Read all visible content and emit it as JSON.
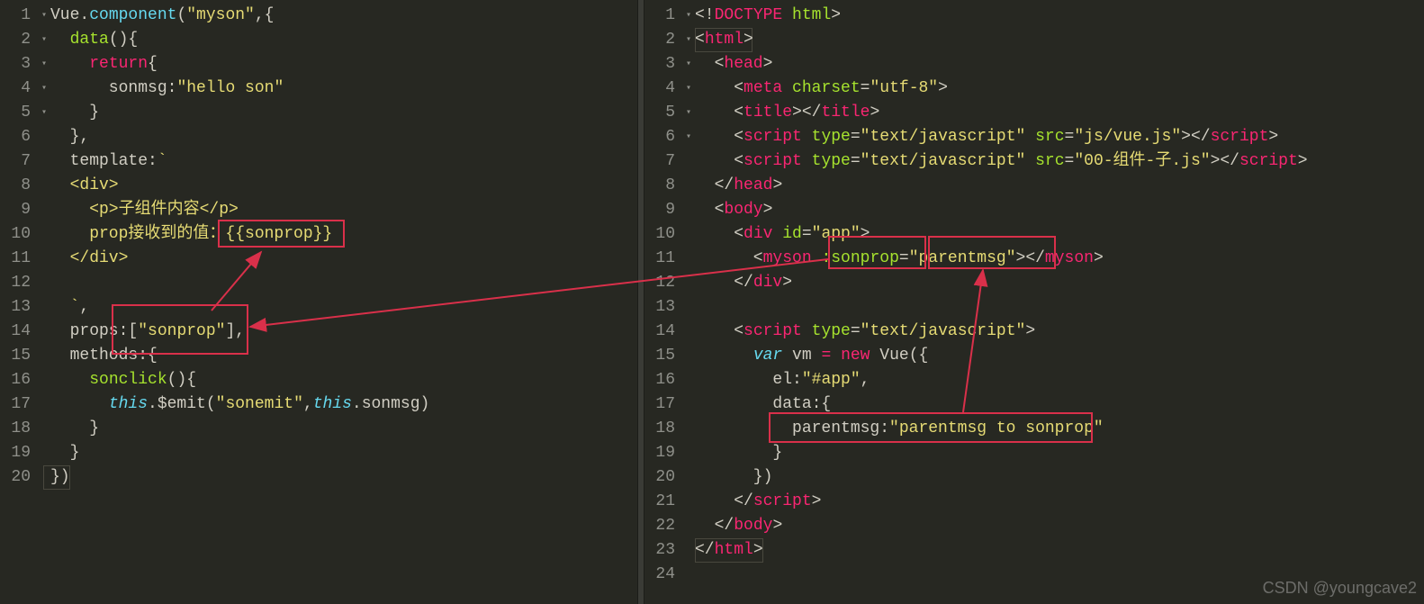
{
  "left": {
    "lines": {
      "l1": {
        "segments": [
          {
            "t": "Vue",
            "c": "default"
          },
          {
            "t": ".",
            "c": "punct"
          },
          {
            "t": "component",
            "c": "builtin"
          },
          {
            "t": "(",
            "c": "punct"
          },
          {
            "t": "\"myson\"",
            "c": "string"
          },
          {
            "t": ",{",
            "c": "punct"
          }
        ]
      },
      "l2": {
        "segments": [
          {
            "t": "  ",
            "c": "default"
          },
          {
            "t": "data",
            "c": "name"
          },
          {
            "t": "(){",
            "c": "punct"
          }
        ]
      },
      "l3": {
        "segments": [
          {
            "t": "    ",
            "c": "default"
          },
          {
            "t": "return",
            "c": "keyword"
          },
          {
            "t": "{",
            "c": "punct"
          }
        ]
      },
      "l4": {
        "segments": [
          {
            "t": "      sonmsg",
            "c": "default"
          },
          {
            "t": ":",
            "c": "punct"
          },
          {
            "t": "\"hello son\"",
            "c": "string"
          }
        ]
      },
      "l5": {
        "segments": [
          {
            "t": "    }",
            "c": "punct"
          }
        ]
      },
      "l6": {
        "segments": [
          {
            "t": "  },",
            "c": "punct"
          }
        ]
      },
      "l7": {
        "segments": [
          {
            "t": "  template",
            "c": "default"
          },
          {
            "t": ":",
            "c": "punct"
          },
          {
            "t": "`",
            "c": "tstr"
          }
        ]
      },
      "l8": {
        "segments": [
          {
            "t": "  <div>",
            "c": "tstr"
          }
        ]
      },
      "l9": {
        "segments": [
          {
            "t": "    <p>子组件内容</p>",
            "c": "tstr"
          }
        ]
      },
      "l10": {
        "segments": [
          {
            "t": "    prop接收到的值：{{sonprop}}",
            "c": "tstr"
          }
        ]
      },
      "l11": {
        "segments": [
          {
            "t": "  </div>",
            "c": "tstr"
          }
        ]
      },
      "l12": {
        "segments": [
          {
            "t": "",
            "c": "default"
          }
        ]
      },
      "l13": {
        "segments": [
          {
            "t": "  `",
            "c": "tstr"
          },
          {
            "t": ",",
            "c": "punct"
          }
        ]
      },
      "l14": {
        "segments": [
          {
            "t": "  props",
            "c": "default"
          },
          {
            "t": ":[",
            "c": "punct"
          },
          {
            "t": "\"sonprop\"",
            "c": "string"
          },
          {
            "t": "],",
            "c": "punct"
          }
        ]
      },
      "l15": {
        "segments": [
          {
            "t": "  methods",
            "c": "default"
          },
          {
            "t": ":{",
            "c": "punct"
          }
        ]
      },
      "l16": {
        "segments": [
          {
            "t": "    ",
            "c": "default"
          },
          {
            "t": "sonclick",
            "c": "name"
          },
          {
            "t": "(){",
            "c": "punct"
          }
        ]
      },
      "l17": {
        "segments": [
          {
            "t": "      ",
            "c": "default"
          },
          {
            "t": "this",
            "c": "this"
          },
          {
            "t": ".$emit(",
            "c": "punct"
          },
          {
            "t": "\"sonemit\"",
            "c": "string"
          },
          {
            "t": ",",
            "c": "punct"
          },
          {
            "t": "this",
            "c": "this"
          },
          {
            "t": ".sonmsg)",
            "c": "punct"
          }
        ]
      },
      "l18": {
        "segments": [
          {
            "t": "    }",
            "c": "punct"
          }
        ]
      },
      "l19": {
        "segments": [
          {
            "t": "  }",
            "c": "punct"
          }
        ]
      },
      "l20": {
        "segments": [
          {
            "t": "})",
            "c": "punct"
          }
        ]
      }
    },
    "gutter": [
      "1",
      "2",
      "3",
      "4",
      "5",
      "6",
      "7",
      "8",
      "9",
      "10",
      "11",
      "12",
      "13",
      "14",
      "15",
      "16",
      "17",
      "18",
      "19",
      "20"
    ],
    "folds": [
      "▾",
      "▾",
      "▾",
      "",
      "",
      "",
      "",
      "",
      "",
      "",
      "",
      "",
      "",
      "",
      "▾",
      "▾",
      "",
      "",
      "",
      ""
    ]
  },
  "right": {
    "lines": {
      "l1": {
        "segments": [
          {
            "t": "<!",
            "c": "punct"
          },
          {
            "t": "DOCTYPE",
            "c": "tag"
          },
          {
            "t": " ",
            "c": "default"
          },
          {
            "t": "html",
            "c": "attr"
          },
          {
            "t": ">",
            "c": "punct"
          }
        ]
      },
      "l2": {
        "segments": [
          {
            "t": "<",
            "c": "punct"
          },
          {
            "t": "html",
            "c": "tag"
          },
          {
            "t": ">",
            "c": "punct"
          }
        ]
      },
      "l3": {
        "segments": [
          {
            "t": "  <",
            "c": "punct"
          },
          {
            "t": "head",
            "c": "tag"
          },
          {
            "t": ">",
            "c": "punct"
          }
        ]
      },
      "l4": {
        "segments": [
          {
            "t": "    <",
            "c": "punct"
          },
          {
            "t": "meta",
            "c": "tag"
          },
          {
            "t": " ",
            "c": "default"
          },
          {
            "t": "charset",
            "c": "attr"
          },
          {
            "t": "=",
            "c": "punct"
          },
          {
            "t": "\"utf-8\"",
            "c": "string"
          },
          {
            "t": ">",
            "c": "punct"
          }
        ]
      },
      "l5": {
        "segments": [
          {
            "t": "    <",
            "c": "punct"
          },
          {
            "t": "title",
            "c": "tag"
          },
          {
            "t": "></",
            "c": "punct"
          },
          {
            "t": "title",
            "c": "tag"
          },
          {
            "t": ">",
            "c": "punct"
          }
        ]
      },
      "l6": {
        "segments": [
          {
            "t": "    <",
            "c": "punct"
          },
          {
            "t": "script",
            "c": "tag"
          },
          {
            "t": " ",
            "c": "default"
          },
          {
            "t": "type",
            "c": "attr"
          },
          {
            "t": "=",
            "c": "punct"
          },
          {
            "t": "\"text/javascript\"",
            "c": "string"
          },
          {
            "t": " ",
            "c": "default"
          },
          {
            "t": "src",
            "c": "attr"
          },
          {
            "t": "=",
            "c": "punct"
          },
          {
            "t": "\"js/vue.js\"",
            "c": "string"
          },
          {
            "t": "></",
            "c": "punct"
          },
          {
            "t": "script",
            "c": "tag"
          },
          {
            "t": ">",
            "c": "punct"
          }
        ]
      },
      "l7": {
        "segments": [
          {
            "t": "    <",
            "c": "punct"
          },
          {
            "t": "script",
            "c": "tag"
          },
          {
            "t": " ",
            "c": "default"
          },
          {
            "t": "type",
            "c": "attr"
          },
          {
            "t": "=",
            "c": "punct"
          },
          {
            "t": "\"text/javascript\"",
            "c": "string"
          },
          {
            "t": " ",
            "c": "default"
          },
          {
            "t": "src",
            "c": "attr"
          },
          {
            "t": "=",
            "c": "punct"
          },
          {
            "t": "\"00-组件-子.js\"",
            "c": "string"
          },
          {
            "t": "></",
            "c": "punct"
          },
          {
            "t": "script",
            "c": "tag"
          },
          {
            "t": ">",
            "c": "punct"
          }
        ]
      },
      "l8": {
        "segments": [
          {
            "t": "  </",
            "c": "punct"
          },
          {
            "t": "head",
            "c": "tag"
          },
          {
            "t": ">",
            "c": "punct"
          }
        ]
      },
      "l9": {
        "segments": [
          {
            "t": "  <",
            "c": "punct"
          },
          {
            "t": "body",
            "c": "tag"
          },
          {
            "t": ">",
            "c": "punct"
          }
        ]
      },
      "l10": {
        "segments": [
          {
            "t": "    <",
            "c": "punct"
          },
          {
            "t": "div",
            "c": "tag"
          },
          {
            "t": " ",
            "c": "default"
          },
          {
            "t": "id",
            "c": "attr"
          },
          {
            "t": "=",
            "c": "punct"
          },
          {
            "t": "\"app\"",
            "c": "string"
          },
          {
            "t": ">",
            "c": "punct"
          }
        ]
      },
      "l11": {
        "segments": [
          {
            "t": "      <",
            "c": "punct"
          },
          {
            "t": "myson",
            "c": "tag"
          },
          {
            "t": " ",
            "c": "default"
          },
          {
            "t": ":sonprop",
            "c": "attr"
          },
          {
            "t": "=",
            "c": "punct"
          },
          {
            "t": "\"parentmsg\"",
            "c": "string"
          },
          {
            "t": "></",
            "c": "punct"
          },
          {
            "t": "myson",
            "c": "tag"
          },
          {
            "t": ">",
            "c": "punct"
          }
        ]
      },
      "l12": {
        "segments": [
          {
            "t": "    </",
            "c": "punct"
          },
          {
            "t": "div",
            "c": "tag"
          },
          {
            "t": ">",
            "c": "punct"
          }
        ]
      },
      "l13": {
        "segments": [
          {
            "t": "",
            "c": "default"
          }
        ]
      },
      "l14": {
        "segments": [
          {
            "t": "    <",
            "c": "punct"
          },
          {
            "t": "script",
            "c": "tag"
          },
          {
            "t": " ",
            "c": "default"
          },
          {
            "t": "type",
            "c": "attr"
          },
          {
            "t": "=",
            "c": "punct"
          },
          {
            "t": "\"text/javascript\"",
            "c": "string"
          },
          {
            "t": ">",
            "c": "punct"
          }
        ]
      },
      "l15": {
        "segments": [
          {
            "t": "      ",
            "c": "default"
          },
          {
            "t": "var",
            "c": "var"
          },
          {
            "t": " vm ",
            "c": "default"
          },
          {
            "t": "=",
            "c": "keyword"
          },
          {
            "t": " ",
            "c": "default"
          },
          {
            "t": "new",
            "c": "keyword"
          },
          {
            "t": " ",
            "c": "default"
          },
          {
            "t": "Vue",
            "c": "default"
          },
          {
            "t": "({",
            "c": "punct"
          }
        ]
      },
      "l16": {
        "segments": [
          {
            "t": "        el",
            "c": "default"
          },
          {
            "t": ":",
            "c": "punct"
          },
          {
            "t": "\"#app\"",
            "c": "string"
          },
          {
            "t": ",",
            "c": "punct"
          }
        ]
      },
      "l17": {
        "segments": [
          {
            "t": "        data",
            "c": "default"
          },
          {
            "t": ":{",
            "c": "punct"
          }
        ]
      },
      "l18": {
        "segments": [
          {
            "t": "          parentmsg",
            "c": "default"
          },
          {
            "t": ":",
            "c": "punct"
          },
          {
            "t": "\"parentmsg to sonprop\"",
            "c": "string"
          }
        ]
      },
      "l19": {
        "segments": [
          {
            "t": "        }",
            "c": "punct"
          }
        ]
      },
      "l20": {
        "segments": [
          {
            "t": "      })",
            "c": "punct"
          }
        ]
      },
      "l21": {
        "segments": [
          {
            "t": "    </",
            "c": "punct"
          },
          {
            "t": "script",
            "c": "tag"
          },
          {
            "t": ">",
            "c": "punct"
          }
        ]
      },
      "l22": {
        "segments": [
          {
            "t": "  </",
            "c": "punct"
          },
          {
            "t": "body",
            "c": "tag"
          },
          {
            "t": ">",
            "c": "punct"
          }
        ]
      },
      "l23": {
        "segments": [
          {
            "t": "</",
            "c": "punct"
          },
          {
            "t": "html",
            "c": "tag"
          },
          {
            "t": ">",
            "c": "punct"
          }
        ]
      },
      "l24": {
        "segments": [
          {
            "t": "",
            "c": "default"
          }
        ]
      }
    },
    "gutter": [
      "1",
      "2",
      "3",
      "4",
      "5",
      "6",
      "7",
      "8",
      "9",
      "10",
      "11",
      "12",
      "13",
      "14",
      "15",
      "16",
      "17",
      "18",
      "19",
      "20",
      "21",
      "22",
      "23",
      "24"
    ],
    "folds": [
      "",
      "▾",
      "▾",
      "",
      "",
      "",
      "",
      "",
      "▾",
      "▾",
      "",
      "",
      "",
      "",
      "▾",
      "",
      "▾",
      "",
      "",
      "",
      "",
      "",
      "",
      ""
    ]
  },
  "watermark": "CSDN @youngcave2"
}
